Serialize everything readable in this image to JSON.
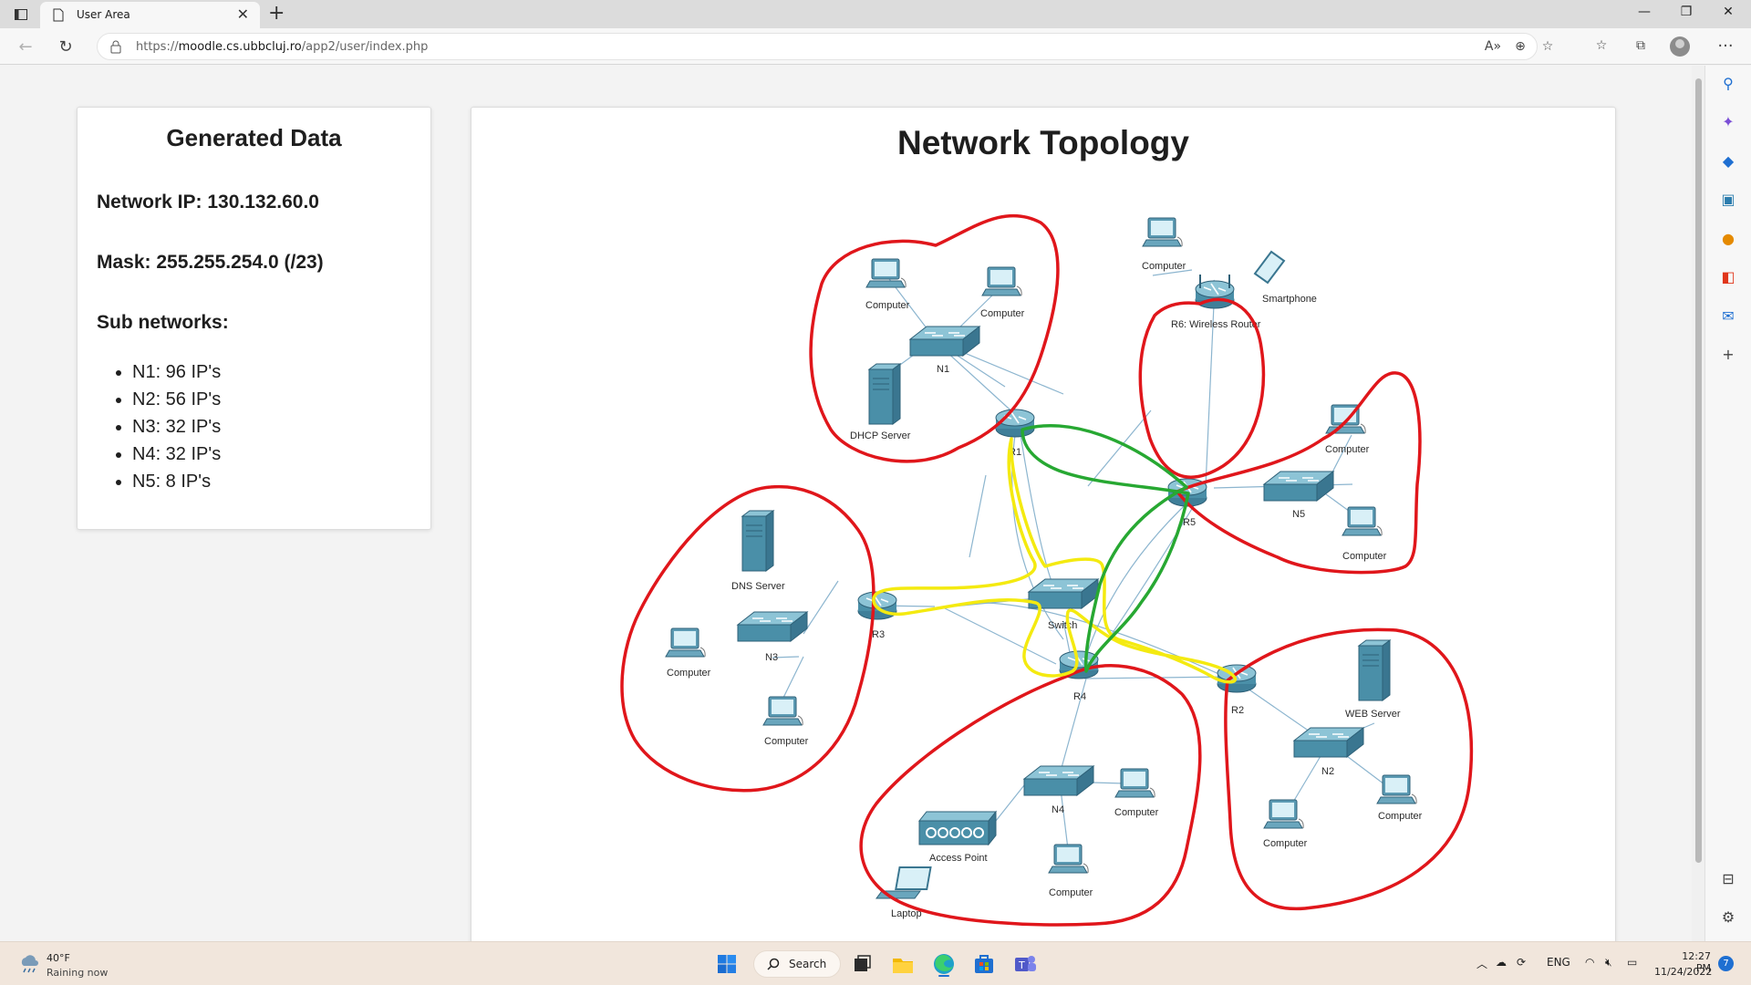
{
  "browser": {
    "tab_title": "User Area",
    "url_prefix": "https://",
    "url_host": "moodle.cs.ubbcluj.ro",
    "url_path": "/app2/user/index.php"
  },
  "generated": {
    "title": "Generated Data",
    "network_ip": "Network IP: 130.132.60.0",
    "mask": "Mask: 255.255.254.0 (/23)",
    "subnets_heading": "Sub networks:",
    "subnets": [
      "N1: 96 IP's",
      "N2: 56 IP's",
      "N3: 32 IP's",
      "N4: 32 IP's",
      "N5: 8 IP's"
    ]
  },
  "topology": {
    "title": "Network Topology",
    "labels": {
      "n1_pc1": "Computer",
      "n1_pc2": "Computer",
      "n1_switch": "N1",
      "n1_dhcp": "DHCP Server",
      "r1": "R1",
      "r6_pc": "Computer",
      "r6_phone": "Smartphone",
      "r6": "R6: Wireless Router",
      "n5_pc1": "Computer",
      "n5_switch": "N5",
      "n5_pc2": "Computer",
      "r5": "R5",
      "n3_dns": "DNS Server",
      "n3_pc1": "Computer",
      "n3_switch": "N3",
      "n3_pc2": "Computer",
      "r3": "R3",
      "center_switch": "Switch",
      "r4": "R4",
      "r2": "R2",
      "n2_web": "WEB Server",
      "n2_switch": "N2",
      "n2_pc1": "Computer",
      "n2_pc2": "Computer",
      "n4_switch": "N4",
      "n4_pc1": "Computer",
      "n4_ap": "Access Point",
      "n4_pc2": "Computer",
      "n4_laptop": "Laptop"
    }
  },
  "taskbar": {
    "weather_temp": "40°F",
    "weather_desc": "Raining now",
    "search_label": "Search",
    "language": "ENG",
    "time": "12:27 PM",
    "date": "11/24/2022",
    "notification_count": "7"
  },
  "colors": {
    "annotation_red": "#e0161b",
    "annotation_yellow": "#f4ea10",
    "annotation_green": "#27a832",
    "device_teal": "#4a8fa8"
  }
}
